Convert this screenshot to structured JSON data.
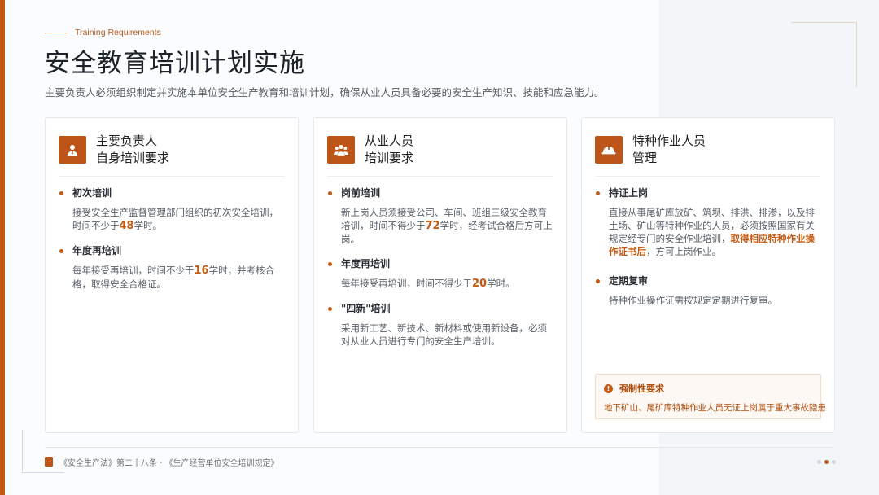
{
  "header": {
    "kicker": "Training Requirements",
    "title": "安全教育培训计划实施",
    "subtitle": "主要负责人必须组织制定并实施本单位安全生产教育和培训计划，确保从业人员具备必要的安全生产知识、技能和应急能力。"
  },
  "cards": [
    {
      "icon": "person-icon",
      "title_line1": "主要负责人",
      "title_line2": "自身培训要求",
      "items": [
        {
          "title": "初次培训",
          "body_pre": "接受安全生产监督管理部门组织的初次安全培训，时间不少于",
          "num": "48",
          "body_post": "学时。"
        },
        {
          "title": "年度再培训",
          "body_pre": "每年接受再培训，时间不少于",
          "num": "16",
          "body_post": "学时，并考核合格，取得安全合格证。"
        }
      ]
    },
    {
      "icon": "people-group-icon",
      "title_line1": "从业人员",
      "title_line2": "培训要求",
      "items": [
        {
          "title": "岗前培训",
          "body_pre": "新上岗人员须接受公司、车间、班组三级安全教育培训，时间不得少于",
          "num": "72",
          "body_post": "学时，经考试合格后方可上岗。"
        },
        {
          "title": "年度再培训",
          "body_pre": "每年接受再培训，时间不得少于",
          "num": "20",
          "body_post": "学时。"
        },
        {
          "title": "\"四新\"培训",
          "body_pre": "采用新工艺、新技术、新材料或使用新设备，必须对从业人员进行专门的安全生产培训。",
          "num": "",
          "body_post": ""
        }
      ]
    },
    {
      "icon": "hard-hat-icon",
      "title_line1": "特种作业人员",
      "title_line2": "管理",
      "items": [
        {
          "title": "持证上岗",
          "body_pre": "直接从事尾矿库放矿、筑坝、排洪、排渗，以及排土场、矿山等特种作业的人员，必须按照国家有关规定经专门的安全作业培训，",
          "highlight": "取得相应特种作业操作证书后",
          "body_post": "，方可上岗作业。"
        },
        {
          "title": "定期复审",
          "body_pre": "特种作业操作证需按规定定期进行复审。",
          "highlight": "",
          "body_post": ""
        }
      ],
      "notice": {
        "title": "强制性要求",
        "body": "地下矿山、尾矿库特种作业人员无证上岗属于重大事故隐患"
      }
    }
  ],
  "footer": {
    "text": "《安全生产法》第二十八条 · 《生产经营单位安全培训规定》",
    "page_dots": 3,
    "active_dot": 2
  },
  "colors": {
    "accent": "#c25a12",
    "title": "#1d232b"
  }
}
